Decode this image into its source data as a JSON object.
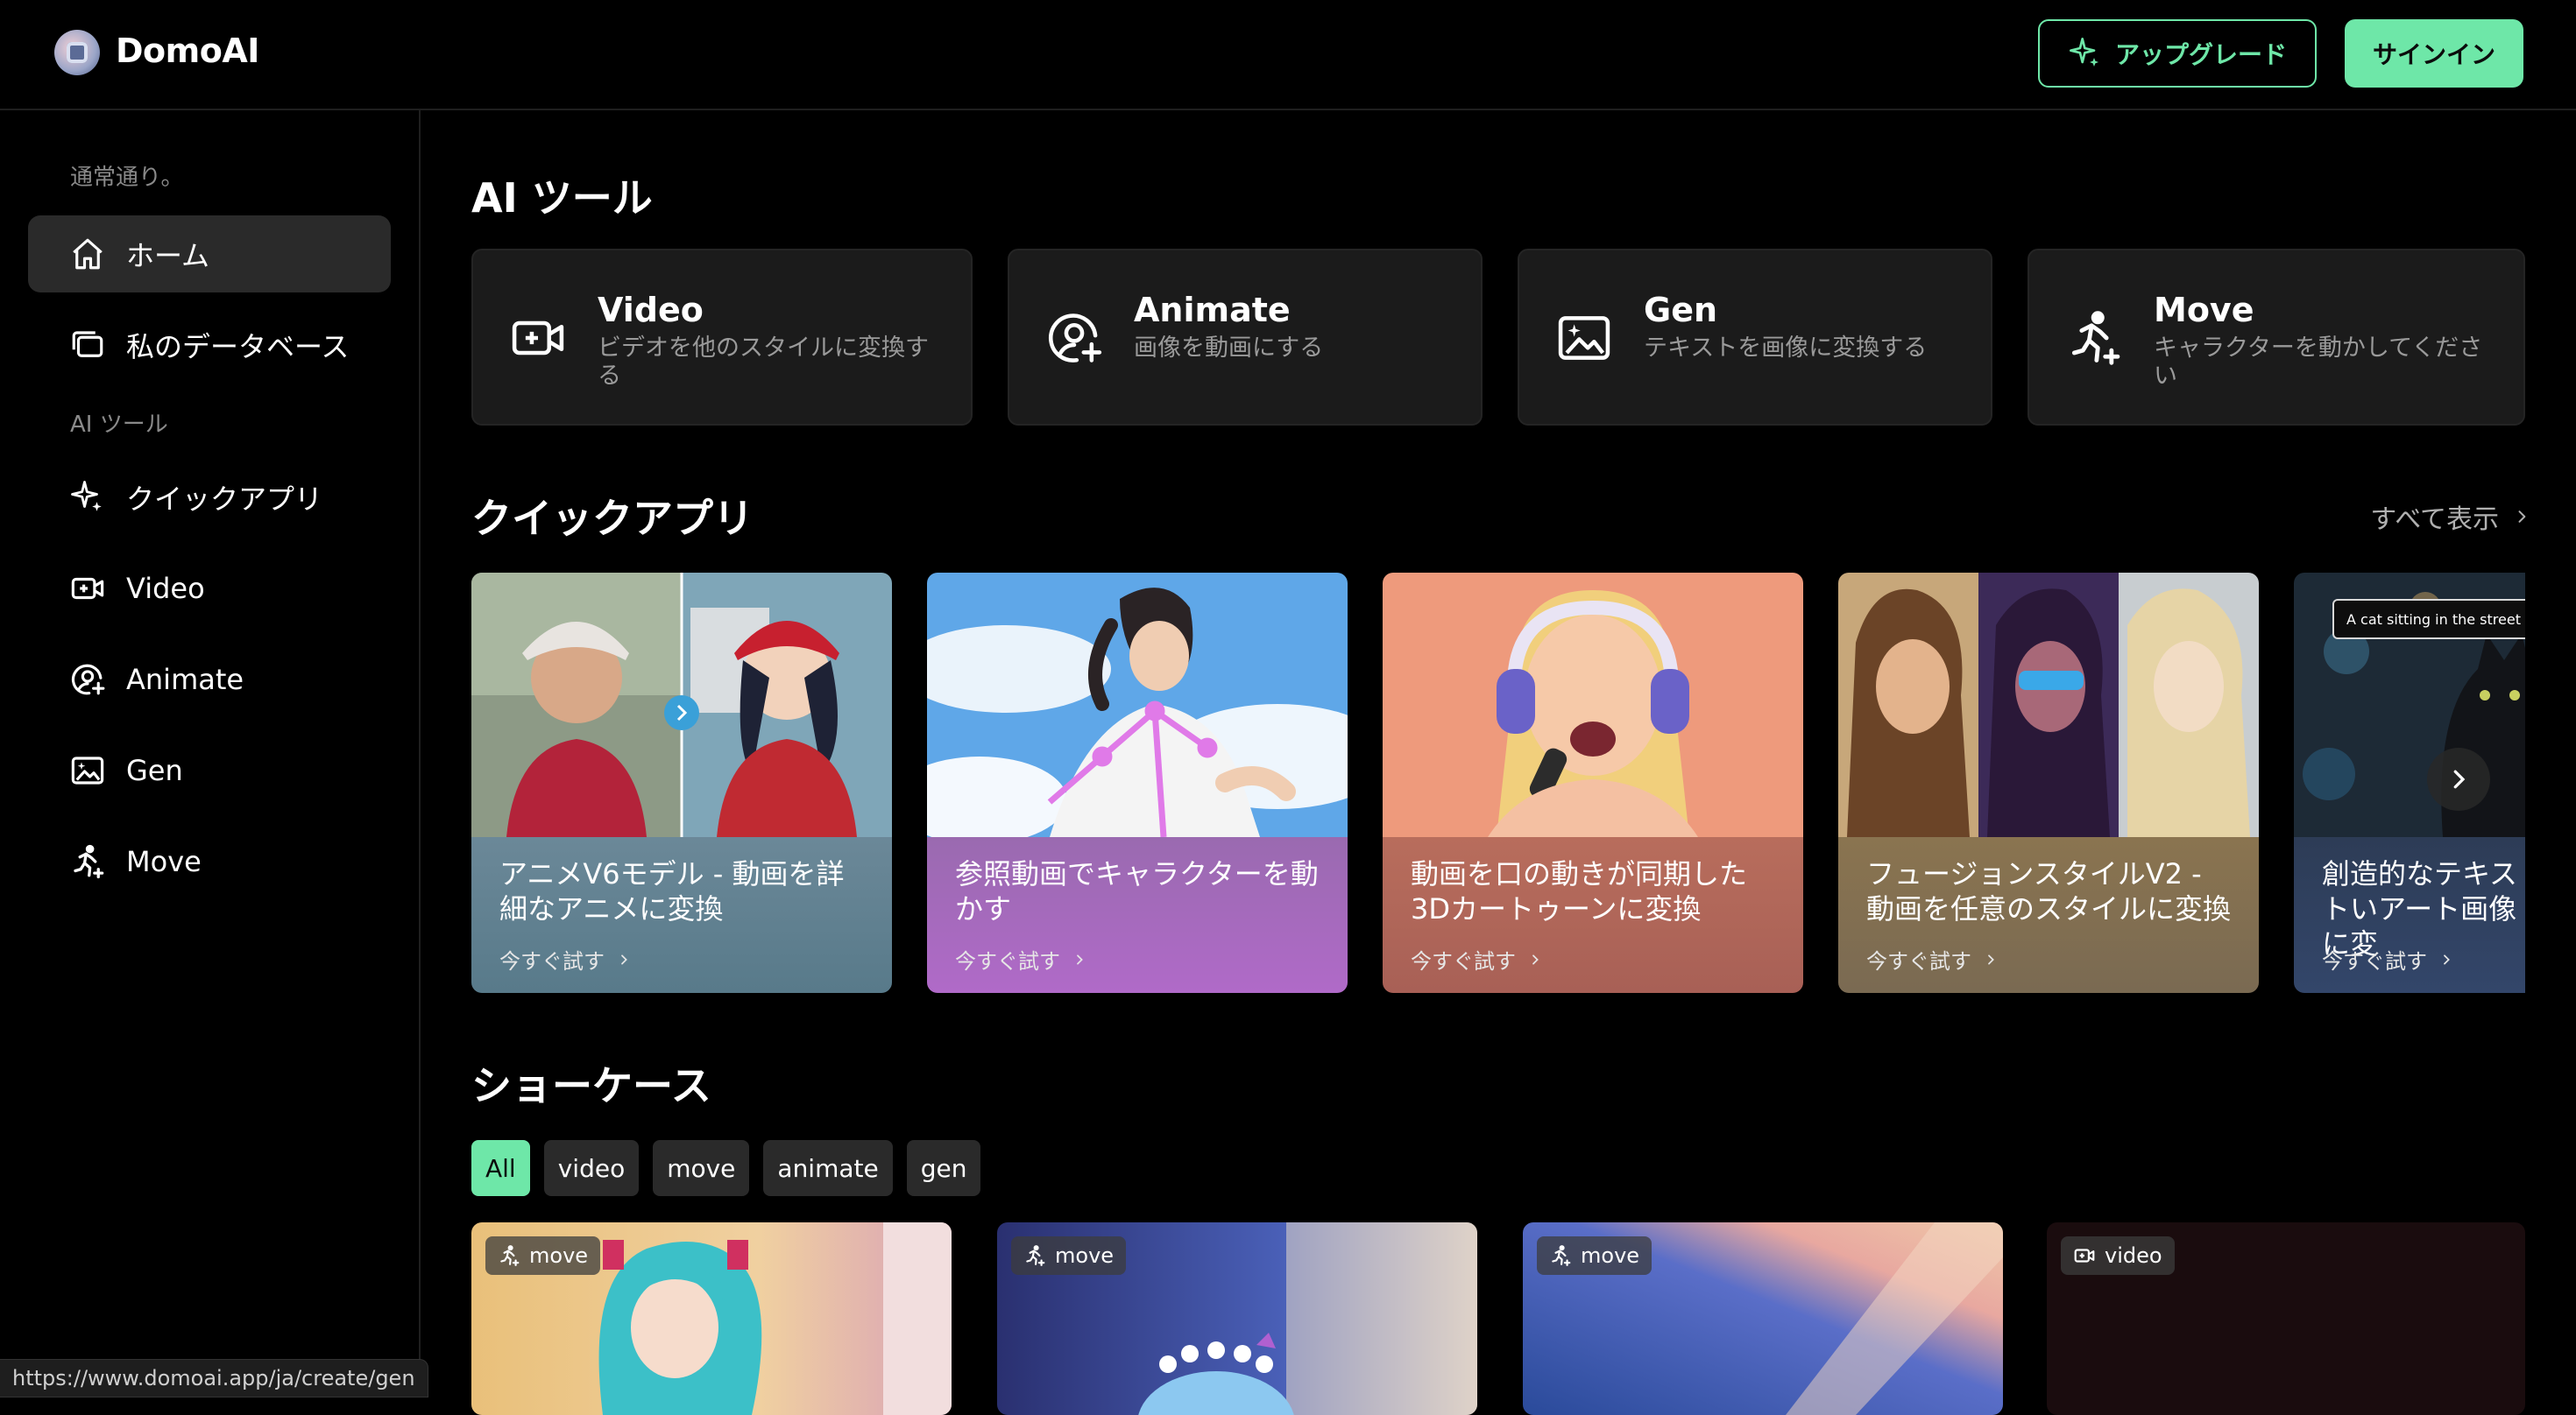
{
  "header": {
    "brand": "DomoAI",
    "upgrade_label": "アップグレード",
    "signin_label": "サインイン",
    "accent_color": "#6ee7a8"
  },
  "sidebar": {
    "section_general": "通常通り。",
    "section_tools": "AI ツール",
    "items": [
      {
        "label": "ホーム",
        "icon": "home-icon",
        "active": true
      },
      {
        "label": "私のデータベース",
        "icon": "library-icon"
      },
      {
        "label": "クイックアプリ",
        "icon": "sparkle-icon"
      },
      {
        "label": "Video",
        "icon": "video-icon"
      },
      {
        "label": "Animate",
        "icon": "animate-icon"
      },
      {
        "label": "Gen",
        "icon": "image-icon"
      },
      {
        "label": "Move",
        "icon": "move-icon"
      }
    ]
  },
  "ai_tools": {
    "title": "AI ツール",
    "cards": [
      {
        "title": "Video",
        "desc": "ビデオを他のスタイルに変換する",
        "icon": "video-icon"
      },
      {
        "title": "Animate",
        "desc": "画像を動画にする",
        "icon": "animate-icon"
      },
      {
        "title": "Gen",
        "desc": "テキストを画像に変換する",
        "icon": "image-icon"
      },
      {
        "title": "Move",
        "desc": "キャラクターを動かしてください",
        "icon": "move-icon"
      }
    ]
  },
  "quick_apps": {
    "title": "クイックアプリ",
    "see_all": "すべて表示",
    "try_label": "今すぐ試す",
    "items": [
      {
        "title": "アニメV6モデル - 動画を詳細なアニメに変換"
      },
      {
        "title": "参照動画でキャラクターを動かす"
      },
      {
        "title": "動画を口の動きが同期した3Dカートゥーンに変換"
      },
      {
        "title": "フュージョンスタイルV2 - 動画を任意のスタイルに変換"
      },
      {
        "title": "創造的なテキストいアート画像に変",
        "overlay_text": "A cat sitting in the street of a c"
      }
    ]
  },
  "showcase": {
    "title": "ショーケース",
    "filters": [
      "All",
      "video",
      "move",
      "animate",
      "gen"
    ],
    "active_filter": "All",
    "cards": [
      {
        "badge": "move",
        "icon": "move-icon"
      },
      {
        "badge": "move",
        "icon": "move-icon"
      },
      {
        "badge": "move",
        "icon": "move-icon"
      },
      {
        "badge": "video",
        "icon": "video-icon"
      }
    ]
  },
  "status_url": "https://www.domoai.app/ja/create/gen"
}
